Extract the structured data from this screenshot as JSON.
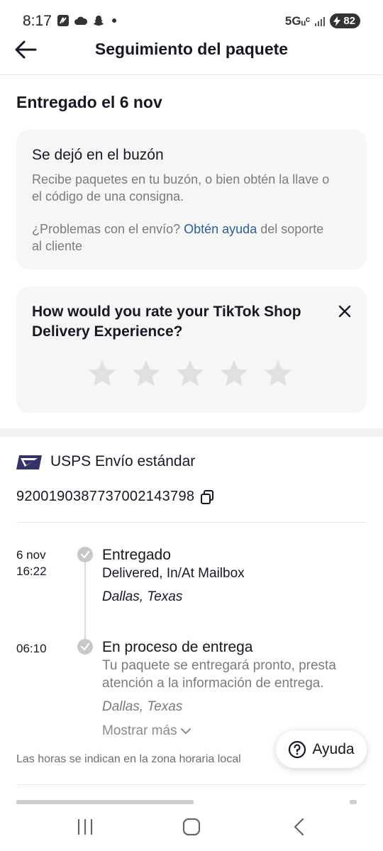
{
  "status_bar": {
    "time": "8:17",
    "network": "5Gᵤᶜ",
    "battery": "82"
  },
  "header": {
    "title": "Seguimiento del paquete"
  },
  "delivery": {
    "heading": "Entregado el 6 nov",
    "card_title": "Se dejó en el buzón",
    "card_description": "Recibe paquetes en tu buzón, o bien obtén la llave o el código de una consigna.",
    "support_prefix": "¿Problemas con el envío? ",
    "support_link": "Obtén ayuda",
    "support_suffix": " del soporte al cliente"
  },
  "rating": {
    "question": "How would you rate your TikTok Shop Delivery Experience?",
    "stars": 5
  },
  "carrier": {
    "name": "USPS Envío estándar",
    "tracking_number": "9200190387737002143798"
  },
  "timeline": [
    {
      "date": "6 nov",
      "time": "16:22",
      "title": "Entregado",
      "description": "Delivered, In/At Mailbox",
      "location": "Dallas, Texas"
    },
    {
      "date": "",
      "time": "06:10",
      "title": "En proceso de entrega",
      "description": "Tu paquete se entregará pronto, presta atención a la información de entrega.",
      "location": "Dallas, Texas"
    }
  ],
  "show_more": "Mostrar más",
  "timezone_note": "Las horas se indican en la zona horaria local",
  "help_button": "Ayuda",
  "colors": {
    "link": "#2b5d9c",
    "muted_text": "#7a7b80",
    "card_bg": "#f6f6f6",
    "star": "#e0e0e0",
    "usps_blue": "#333366"
  }
}
